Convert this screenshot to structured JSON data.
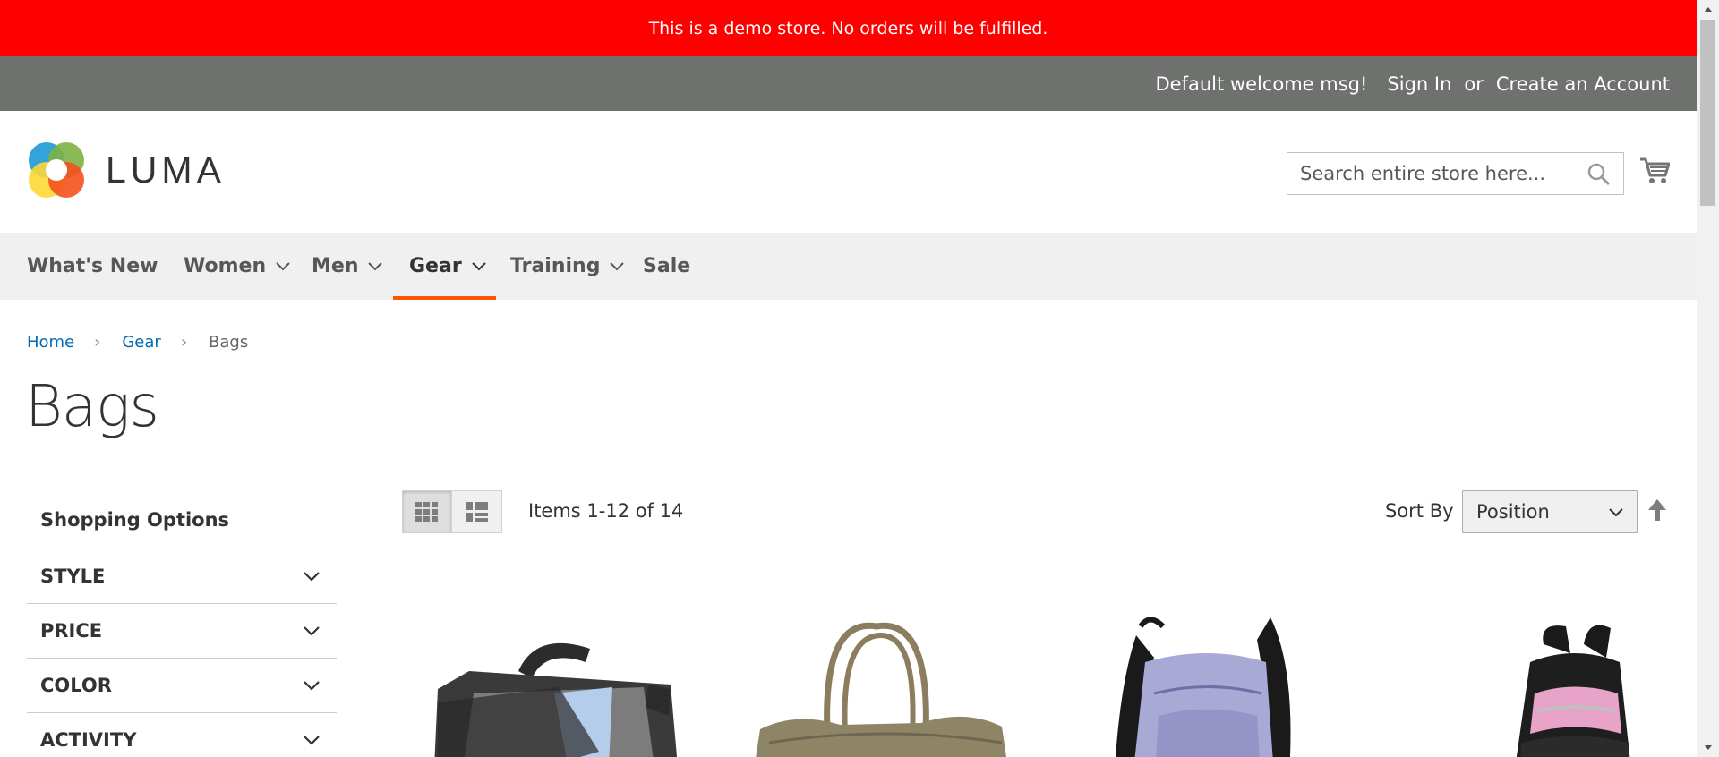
{
  "demo_notice": "This is a demo store. No orders will be fulfilled.",
  "panel_header": {
    "welcome": "Default welcome msg!",
    "sign_in": "Sign In",
    "or": "or",
    "create_account": "Create an Account"
  },
  "header": {
    "logo_text": "LUMA",
    "search_placeholder": "Search entire store here..."
  },
  "nav": {
    "items": [
      {
        "label": "What's New",
        "has_submenu": false
      },
      {
        "label": "Women",
        "has_submenu": true
      },
      {
        "label": "Men",
        "has_submenu": true
      },
      {
        "label": "Gear",
        "has_submenu": true,
        "active": true
      },
      {
        "label": "Training",
        "has_submenu": true
      },
      {
        "label": "Sale",
        "has_submenu": false
      }
    ],
    "active_color": "#ff5501"
  },
  "breadcrumb": {
    "home": "Home",
    "gear": "Gear",
    "current": "Bags",
    "separator": "›"
  },
  "page_title": "Bags",
  "sidebar": {
    "title": "Shopping Options",
    "filters": [
      "STYLE",
      "PRICE",
      "COLOR",
      "ACTIVITY"
    ]
  },
  "toolbar": {
    "amount": "Items 1-12 of 14",
    "sort_label": "Sort By",
    "sort_value": "Position",
    "view_modes": [
      "grid",
      "list"
    ],
    "active_mode": "grid"
  },
  "products": [
    {
      "image": "messenger-bag"
    },
    {
      "image": "tote-bag"
    },
    {
      "image": "backpack-lavender"
    },
    {
      "image": "backpack-pink"
    }
  ],
  "colors": {
    "demo_bar": "#ff0000",
    "panel_header": "#6e716e",
    "link": "#006bb4",
    "nav_bg": "#f0f0f0"
  }
}
